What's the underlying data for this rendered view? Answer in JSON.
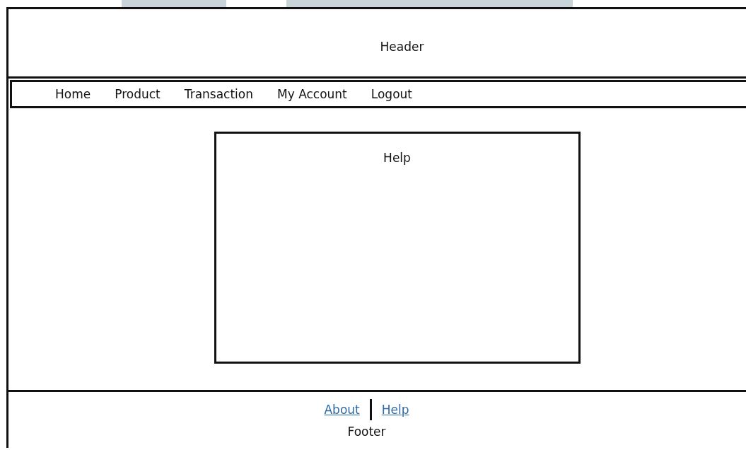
{
  "header": {
    "title": "Header"
  },
  "nav": {
    "items": [
      {
        "label": "Home"
      },
      {
        "label": "Product"
      },
      {
        "label": "Transaction"
      },
      {
        "label": "My Account"
      },
      {
        "label": "Logout"
      }
    ]
  },
  "panel": {
    "title": "Help"
  },
  "footer": {
    "links": [
      {
        "label": "About"
      },
      {
        "label": "Help"
      }
    ],
    "text": "Footer"
  }
}
